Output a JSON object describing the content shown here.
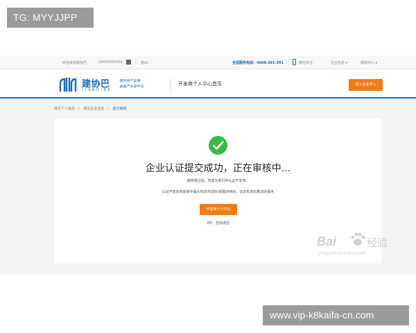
{
  "overlay": {
    "top_tag": "TG: MYYJJPP",
    "bottom_tag": "www.vip-k8kaifa-cn.com"
  },
  "topbar": {
    "welcome": "欢迎来到建协巴",
    "phone": "18665455465",
    "logout": "退出",
    "hotline": "全国服务热线：4008-391-391",
    "wechat": "微信关注",
    "enterprise_info": "企业信息 ▾",
    "help_center": "帮助中心 ▾"
  },
  "header": {
    "logo_cn": "建协巴",
    "logo_en": "JIANDIBA",
    "slogan_line1": "建筑地产资源",
    "slogan_line2": "垂直产业链平台",
    "page_title": "开发商个人中心首页",
    "enter_button": "进入企业中心"
  },
  "breadcrumb": {
    "items": [
      "填写个人信息",
      "填写企业信息",
      "提交审核"
    ]
  },
  "card": {
    "title": "企业认证提交成功，正在审核中...",
    "desc_line1": "审核通过后，将成为我们的认证开发商。",
    "desc_line2": "认证开发商将获得专属在线发布招标/招募的特权，还享有商机推送的服务",
    "center_button": "开发商个人中心",
    "auto_return": "3秒，自动返回"
  },
  "watermark": {
    "brand": "Bai",
    "suffix": "经验",
    "url": "jingyan.baidu.com"
  },
  "colors": {
    "brand_blue": "#1a6bb8",
    "accent_orange": "#f07d14",
    "success_green": "#3cb84a"
  }
}
